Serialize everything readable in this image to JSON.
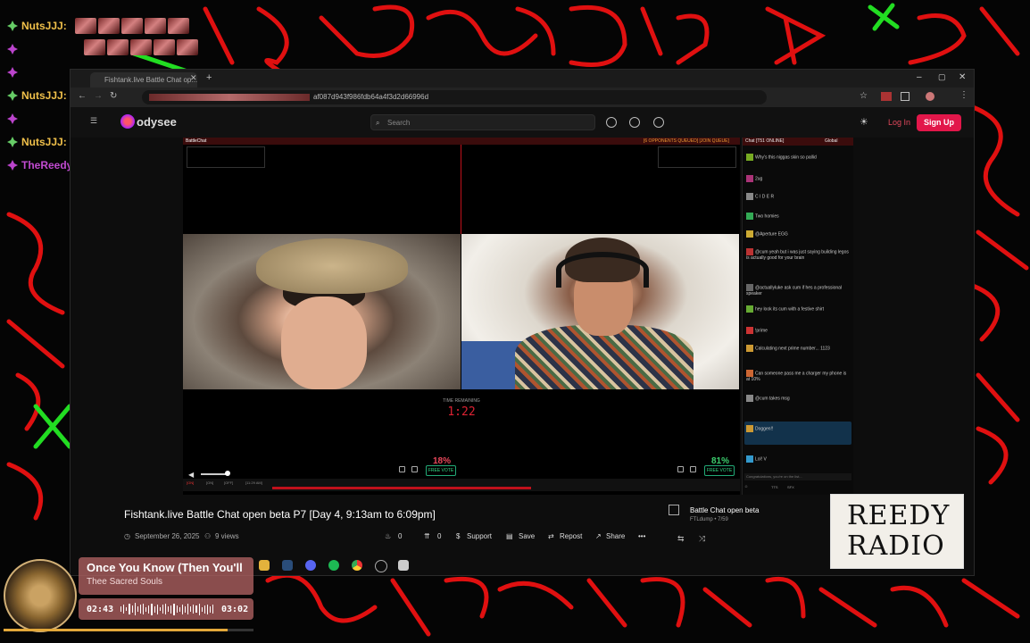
{
  "stream_chat": [
    {
      "user": "NutsJJJ:",
      "color": "#f0c04a"
    },
    {
      "user": "",
      "color": "#c04ad0"
    },
    {
      "user": "",
      "color": "#c04ad0"
    },
    {
      "user": "NutsJJJ:",
      "color": "#f0c04a"
    },
    {
      "user": "",
      "color": "#c04ad0"
    },
    {
      "user": "NutsJJJ:",
      "color": "#f0c04a"
    },
    {
      "user": "TheReedy:",
      "color": "#c04ad0"
    }
  ],
  "browser": {
    "tab_title": "Fishtank.live Battle Chat op...",
    "url": "af087d943f986fdb64a4f3d2d66996d"
  },
  "odysee": {
    "logo": "odysee",
    "search_placeholder": "Search",
    "login_label": "Log In",
    "signup_label": "Sign Up"
  },
  "player": {
    "top_left": "BattleChat",
    "top_right": "[6 OPPONENTS QUEUED] [JOIN QUEUE]",
    "timer_label": "TIME REMAINING",
    "timer": "1:22",
    "left_pct": "18%",
    "right_pct": "81%",
    "free_vote": "FREE VOTE",
    "vote_share_left": 0.18,
    "vote_share_right": 0.81,
    "status_items": [
      "[ON]",
      "[ON]",
      "[OFF]",
      "[11:29 AM]"
    ],
    "progress_label": "10m / 16F MGR"
  },
  "chat": {
    "header": "Chat [T51 ONLINE]",
    "scope": "Global",
    "messages": [
      "Why's this niggas skin so pallid",
      "2ug",
      "C I D E R",
      "Two homies",
      "@Aperture EGG",
      "@cum yeah but i was just saying building legos is actually good for your brain",
      "@actuallyluke ask cum if hes a professional speaker",
      "hey look its cum with a festive shirt",
      "!prime",
      "Calculating next prime number... 1123",
      "Can someone pass me a charger my phone is at 10%",
      "@cum takes msg",
      "Doggen!!",
      "Lol! V"
    ],
    "input_placeholder": "Congratulations, you're on the list...",
    "tools": [
      "TTS",
      "SFX"
    ]
  },
  "video_info": {
    "title": "Fishtank.live Battle Chat open beta P7 [Day 4, 9:13am to 6:09pm]",
    "date": "September 26, 2025",
    "views": "9 views",
    "fire_count": "0",
    "boost_count": "0",
    "support_label": "Support",
    "save_label": "Save",
    "repost_label": "Repost",
    "share_label": "Share",
    "more_label": "•••"
  },
  "recommended": {
    "title": "Battle Chat open beta",
    "channel": "FTLdump • 7/59"
  },
  "logo": {
    "line1": "REEDY",
    "line2": "RADIO"
  },
  "now_playing": {
    "song": "Once You Know (Then You'll",
    "artist": "Thee Sacred Souls",
    "elapsed": "02:43",
    "duration": "03:02",
    "progress": 0.895
  },
  "colors": {
    "accent": "#e2174a",
    "scribble_red": "#e01010",
    "scribble_green": "#22dd22"
  }
}
